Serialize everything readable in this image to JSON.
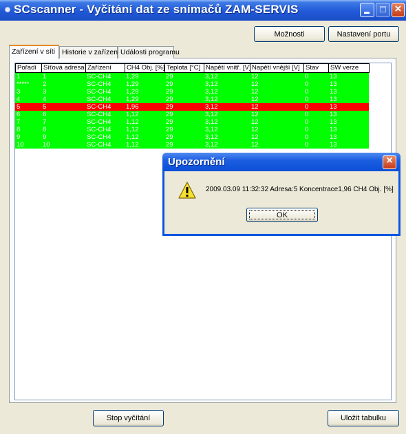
{
  "window": {
    "title": "SCscanner - Vyčítání dat ze snímačů ZAM-SERVIS",
    "controls": {
      "minimize": "minimize",
      "maximize": "maximize",
      "close": "×"
    }
  },
  "toolbar": {
    "options_label": "Možnosti",
    "port_settings_label": "Nastavení portu"
  },
  "tabs": [
    {
      "label": "Zařízení v síti",
      "active": true
    },
    {
      "label": "Historie v zařízení",
      "active": false
    },
    {
      "label": "Události programu",
      "active": false
    }
  ],
  "table": {
    "columns": [
      "Pořadí",
      "Síťová adresa",
      "Zařízení",
      "CH4 Obj. [%]",
      "Teplota [°C]",
      "Napětí vnitř. [V]",
      "Napětí vnější [V]",
      "Stav",
      "SW verze"
    ],
    "rows": [
      {
        "status": "ok",
        "cells": [
          "1",
          "1",
          "SC-CH4",
          "1,29",
          "29",
          "3,12",
          "12",
          "0",
          "13"
        ]
      },
      {
        "status": "ok",
        "cells": [
          "*****",
          "2",
          "SC-CH4",
          "1,29",
          "29",
          "3,12",
          "12",
          "0",
          "13"
        ]
      },
      {
        "status": "ok",
        "cells": [
          "3",
          "3",
          "SC-CH4",
          "1,29",
          "29",
          "3,12",
          "12",
          "0",
          "13"
        ]
      },
      {
        "status": "ok",
        "cells": [
          "4",
          "4",
          "SC-CH4",
          "1,29",
          "29",
          "3,12",
          "12",
          "0",
          "13"
        ]
      },
      {
        "status": "alarm",
        "cells": [
          "5",
          "5",
          "SC-CH4",
          "1,96",
          "29",
          "3,12",
          "12",
          "0",
          "13"
        ]
      },
      {
        "status": "ok",
        "cells": [
          "6",
          "6",
          "SC-CH4",
          "1,12",
          "29",
          "3,12",
          "12",
          "0",
          "13"
        ]
      },
      {
        "status": "ok",
        "cells": [
          "7",
          "7",
          "SC-CH4",
          "1,12",
          "29",
          "3,12",
          "12",
          "0",
          "13"
        ]
      },
      {
        "status": "ok",
        "cells": [
          "8",
          "8",
          "SC-CH4",
          "1,12",
          "29",
          "3,12",
          "12",
          "0",
          "13"
        ]
      },
      {
        "status": "ok",
        "cells": [
          "9",
          "9",
          "SC-CH4",
          "1,12",
          "29",
          "3,12",
          "12",
          "0",
          "13"
        ]
      },
      {
        "status": "ok",
        "cells": [
          "10",
          "10",
          "SC-CH4",
          "1,12",
          "29",
          "3,12",
          "12",
          "0",
          "13"
        ]
      }
    ]
  },
  "colors": {
    "ok": "#00ff00",
    "alarm": "#ff0000",
    "title_bar": "#2259d6"
  },
  "bottom": {
    "stop_label": "Stop vyčítání",
    "save_label": "Uložit tabulku"
  },
  "dialog": {
    "title": "Upozornění",
    "icon": "warning-icon",
    "message": "2009.03.09 11:32:32 Adresa:5 Koncentrace1,96 CH4 Obj. [%]",
    "ok_label": "OK",
    "close": "×"
  }
}
